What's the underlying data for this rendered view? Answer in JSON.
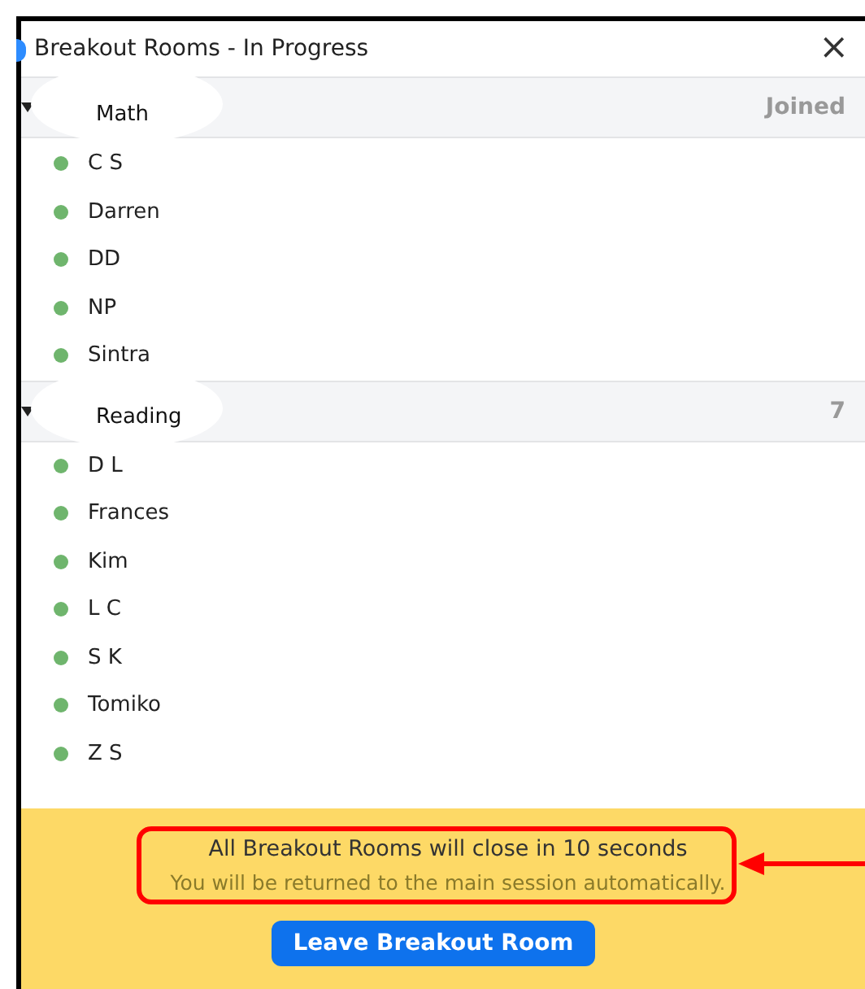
{
  "window": {
    "title": "Breakout Rooms - In Progress",
    "close": "×"
  },
  "rooms": [
    {
      "name": "Math",
      "status": "Joined",
      "expanded": true,
      "members": [
        {
          "name": "C S",
          "color": "#6fb56d"
        },
        {
          "name": "Darren",
          "color": "#6fb56d"
        },
        {
          "name": "DD",
          "color": "#6fb56d"
        },
        {
          "name": "NP",
          "color": "#6fb56d"
        },
        {
          "name": "Sintra",
          "color": "#6fb56d"
        }
      ]
    },
    {
      "name": "Reading",
      "status": "7",
      "expanded": true,
      "members": [
        {
          "name": "D L",
          "color": "#6fb56d"
        },
        {
          "name": "Frances",
          "color": "#6fb56d"
        },
        {
          "name": "Kim",
          "color": "#6fb56d"
        },
        {
          "name": "L C",
          "color": "#6fb56d"
        },
        {
          "name": "S K",
          "color": "#6fb56d"
        },
        {
          "name": "Tomiko",
          "color": "#6fb56d"
        },
        {
          "name": "Z S",
          "color": "#6fb56d"
        }
      ]
    }
  ],
  "footer": {
    "message": "All Breakout Rooms will close in 10 seconds",
    "note": "You will be returned to the main session automatically.",
    "button": "Leave Breakout Room"
  }
}
